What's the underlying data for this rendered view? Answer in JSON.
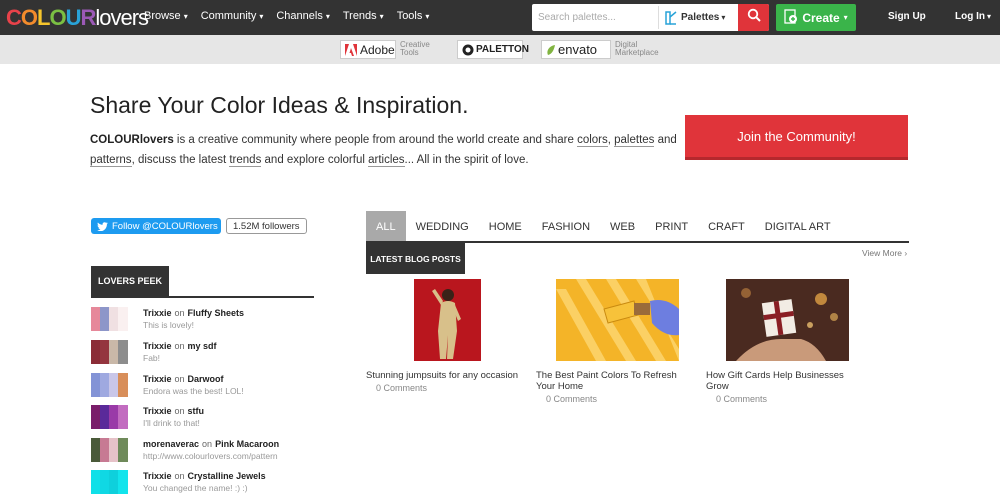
{
  "header": {
    "logo": {
      "colour": "COLOUR",
      "lovers": "lovers"
    },
    "nav": [
      "Browse",
      "Community",
      "Channels",
      "Trends",
      "Tools"
    ],
    "search": {
      "placeholder": "Search palettes...",
      "scope": "Palettes"
    },
    "create_label": "Create",
    "signup_label": "Sign Up",
    "login_label": "Log In"
  },
  "sponsors": [
    {
      "name": "Adobe",
      "sub": "Creative Tools"
    },
    {
      "name": "PALETTON",
      "sub": ""
    },
    {
      "name": "envato",
      "sub": "Digital Marketplace"
    }
  ],
  "hero": {
    "title": "Share Your Color Ideas & Inspiration.",
    "brand": "COLOURlovers",
    "text_1": " is a creative community where people from around the world create and share ",
    "link_colors": "colors",
    "text_2": ", ",
    "link_palettes": "palettes",
    "text_3": " and ",
    "link_patterns": "patterns",
    "text_4": ", discuss the latest ",
    "link_trends": "trends",
    "text_5": " and explore colorful ",
    "link_articles": "articles",
    "text_6": "... All in the spirit of love.",
    "join_label": "Join the Community!"
  },
  "twitter": {
    "follow_label": "Follow @COLOURlovers",
    "followers": "1.52M followers"
  },
  "lovers_peek": {
    "heading": "LOVERS PEEK",
    "items": [
      {
        "user": "Trixxie",
        "on": "on",
        "title": "Fluffy Sheets",
        "comment": "This is lovely!",
        "colors": [
          "#e6889a",
          "#8d96c9",
          "#f0e0e2",
          "#faf0f0"
        ]
      },
      {
        "user": "Trixxie",
        "on": "on",
        "title": "my sdf",
        "comment": "Fab!",
        "colors": [
          "#8b2c37",
          "#94353f",
          "#c9b8a8",
          "#8d8d8d"
        ]
      },
      {
        "user": "Trixxie",
        "on": "on",
        "title": "Darwoof",
        "comment": "Endora was the best! LOL!",
        "colors": [
          "#8393d6",
          "#9fa9e0",
          "#c9c6e8",
          "#d88e5a"
        ]
      },
      {
        "user": "Trixxie",
        "on": "on",
        "title": "stfu",
        "comment": "I'll drink to that!",
        "colors": [
          "#7a1d6a",
          "#5a2a9a",
          "#9a3aa8",
          "#c26cc0"
        ]
      },
      {
        "user": "morenaverac",
        "on": "on",
        "title": "Pink Macaroon",
        "comment": "http://www.colourlovers.com/pattern",
        "colors": [
          "#4a5a3a",
          "#c77a93",
          "#e6c2c8",
          "#6f8a5a"
        ]
      },
      {
        "user": "Trixxie",
        "on": "on",
        "title": "Crystalline Jewels",
        "comment": "You changed the name! :) :)",
        "colors": [
          "#0fe0e8",
          "#10d8e4",
          "#0ed0dc",
          "#12e4ec"
        ]
      }
    ]
  },
  "tabs": [
    "ALL",
    "WEDDING",
    "HOME",
    "FASHION",
    "WEB",
    "PRINT",
    "CRAFT",
    "DIGITAL ART"
  ],
  "blog": {
    "heading": "LATEST BLOG POSTS",
    "view_more": "View More ›",
    "posts": [
      {
        "title": "Stunning jumpsuits for any occasion",
        "comments": "0 Comments"
      },
      {
        "title": "The Best Paint Colors To Refresh Your Home",
        "comments": "0 Comments"
      },
      {
        "title": "How Gift Cards Help Businesses Grow",
        "comments": "0 Comments"
      }
    ]
  },
  "colors": {
    "accent": "#e0343a",
    "create": "#3ab44a",
    "nav_bg": "#333333",
    "twitter": "#1d9bf0"
  }
}
